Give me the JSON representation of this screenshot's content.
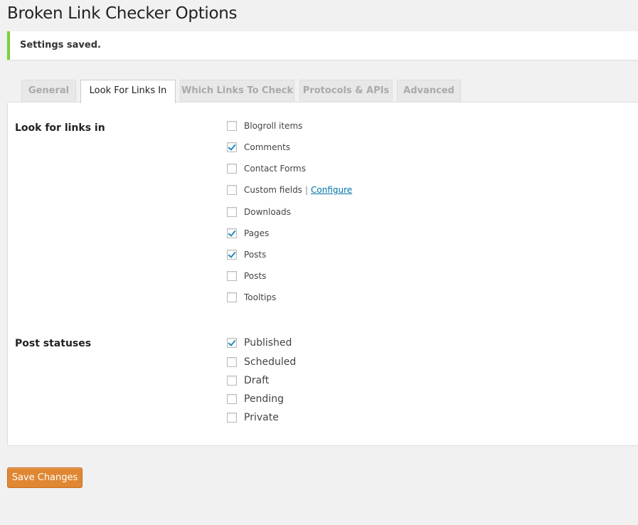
{
  "page": {
    "title": "Broken Link Checker Options"
  },
  "notice": {
    "text": "Settings saved.",
    "accent_color": "#7ad03a"
  },
  "tabs": [
    {
      "label": "General",
      "active": false
    },
    {
      "label": "Look For Links In",
      "active": true
    },
    {
      "label": "Which Links To Check",
      "active": false
    },
    {
      "label": "Protocols & APIs",
      "active": false
    },
    {
      "label": "Advanced",
      "active": false
    }
  ],
  "look_for_links": {
    "label": "Look for links in",
    "options": [
      {
        "label": "Blogroll items",
        "checked": false
      },
      {
        "label": "Comments",
        "checked": true
      },
      {
        "label": "Contact Forms",
        "checked": false
      },
      {
        "label": "Custom fields",
        "checked": false,
        "separator": "|",
        "link": "Configure"
      },
      {
        "label": "Downloads",
        "checked": false
      },
      {
        "label": "Pages",
        "checked": true
      },
      {
        "label": "Posts",
        "checked": true
      },
      {
        "label": "Posts",
        "checked": false
      },
      {
        "label": "Tooltips",
        "checked": false
      }
    ]
  },
  "post_statuses": {
    "label": "Post statuses",
    "options": [
      {
        "label": "Published",
        "checked": true
      },
      {
        "label": "Scheduled",
        "checked": false
      },
      {
        "label": "Draft",
        "checked": false
      },
      {
        "label": "Pending",
        "checked": false
      },
      {
        "label": "Private",
        "checked": false
      }
    ]
  },
  "actions": {
    "save_label": "Save Changes",
    "save_color": "#e08733"
  },
  "icons": {
    "checkbox": "checkbox-icon"
  }
}
